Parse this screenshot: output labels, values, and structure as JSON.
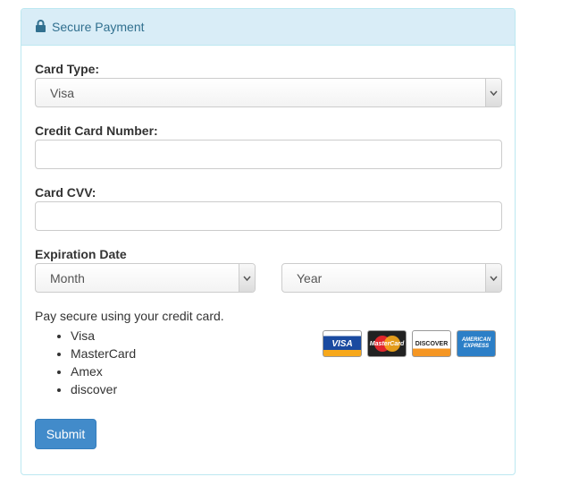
{
  "panel": {
    "title": "Secure Payment",
    "icon": "lock-icon"
  },
  "form": {
    "card_type": {
      "label": "Card Type:",
      "value": "Visa"
    },
    "card_number": {
      "label": "Credit Card Number:",
      "value": ""
    },
    "card_cvv": {
      "label": "Card CVV:",
      "value": ""
    },
    "expiration": {
      "label": "Expiration Date",
      "month": "Month",
      "year": "Year"
    }
  },
  "info": {
    "text": "Pay secure using your credit card.",
    "items": [
      "Visa",
      "MasterCard",
      "Amex",
      "discover"
    ]
  },
  "cards": {
    "visa": "VISA",
    "mastercard": "MasterCard",
    "discover": "DISCOVER",
    "amex": "AMERICAN EXPRESS"
  },
  "submit_label": "Submit",
  "colors": {
    "accent": "#428bca",
    "heading_bg": "#d9edf7",
    "heading_text": "#31708f"
  }
}
